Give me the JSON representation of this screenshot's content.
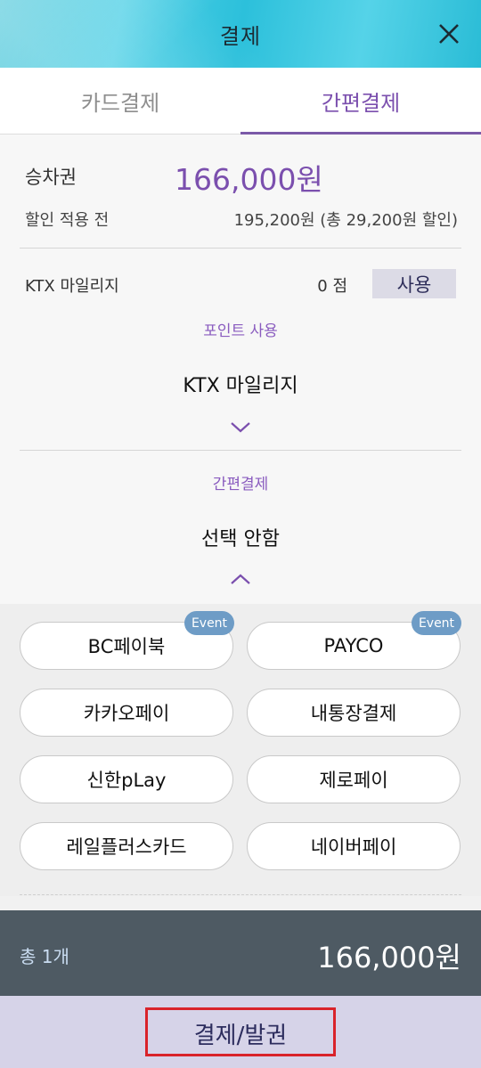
{
  "header": {
    "title": "결제"
  },
  "tabs": [
    {
      "label": "카드결제"
    },
    {
      "label": "간편결제"
    }
  ],
  "ticket": {
    "label": "승차권",
    "price": "166,000원"
  },
  "discount": {
    "label": "할인 적용 전",
    "value": "195,200원 (총 29,200원 할인)"
  },
  "mileage": {
    "label": "KTX 마일리지",
    "points": "0 점",
    "use_button": "사용"
  },
  "point_use": {
    "caption": "포인트 사용",
    "value": "KTX 마일리지"
  },
  "easy_pay": {
    "caption": "간편결제",
    "value": "선택 안함",
    "options": [
      {
        "label": "BC페이북",
        "badge": "Event"
      },
      {
        "label": "PAYCO",
        "badge": "Event"
      },
      {
        "label": "카카오페이"
      },
      {
        "label": "내통장결제"
      },
      {
        "label": "신한pLay"
      },
      {
        "label": "제로페이"
      },
      {
        "label": "레일플러스카드"
      },
      {
        "label": "네이버페이"
      }
    ]
  },
  "total": {
    "count": "총 1개",
    "price": "166,000원"
  },
  "pay_button": {
    "label": "결제/발권"
  },
  "colors": {
    "accent": "#7b4fae",
    "header_teal": "#2cc0db",
    "total_bar": "#4e5a63",
    "badge": "#6e9cc6",
    "highlight_red": "#d9232a"
  }
}
